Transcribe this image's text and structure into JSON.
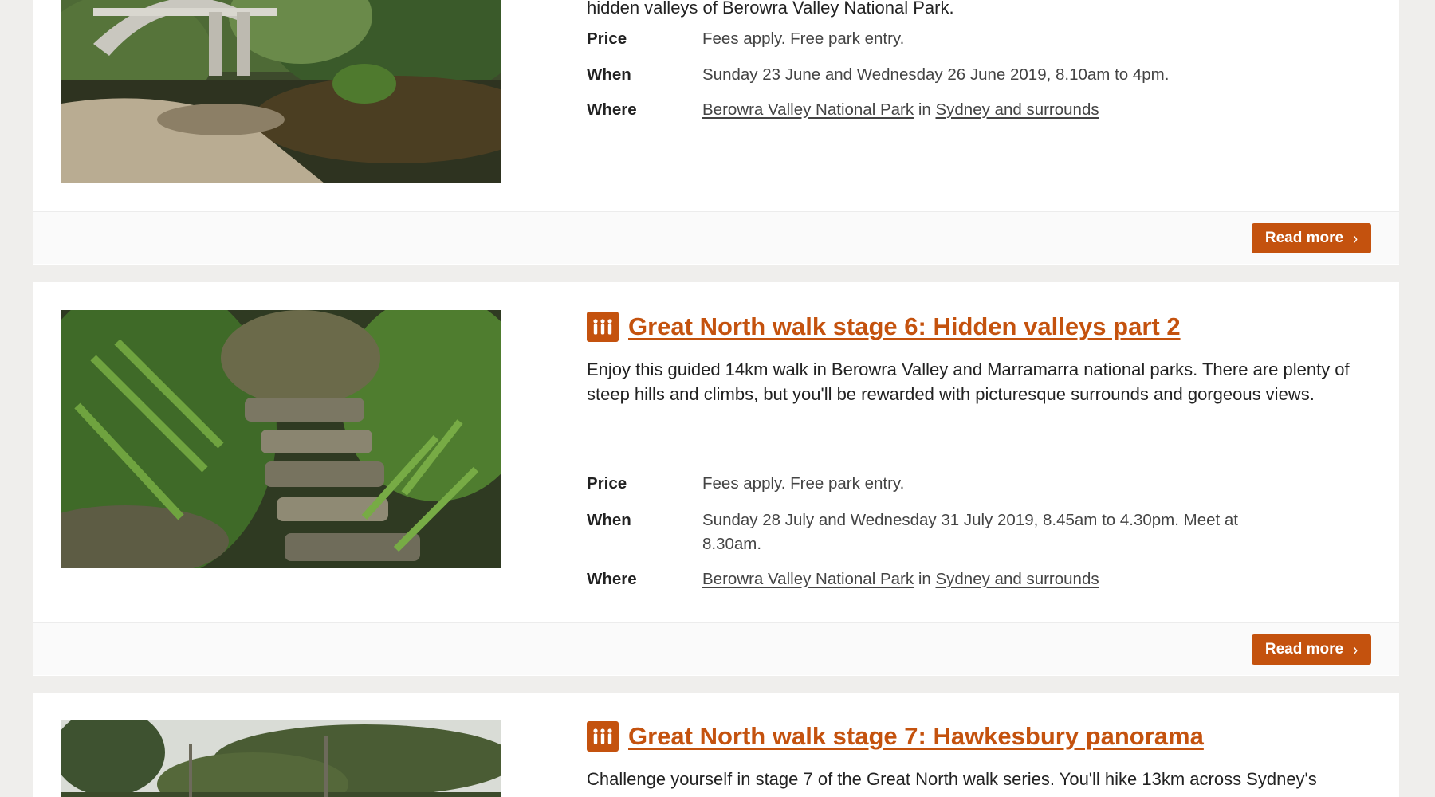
{
  "icons": {
    "walk": "guided-walk-people-icon",
    "chevron": "chevron-right-icon"
  },
  "colors": {
    "accent": "#c4520e",
    "background": "#efeeec",
    "card": "#ffffff",
    "footer": "#fafafa"
  },
  "labels": {
    "price": "Price",
    "when": "When",
    "where": "Where",
    "read_more": "Read more",
    "chevron": "›",
    "in": "in"
  },
  "cards": [
    {
      "desc_tail": "hidden valleys of Berowra Valley National Park.",
      "price": "Fees apply. Free park entry.",
      "when": "Sunday 23 June and Wednesday 26 June 2019, 8.10am to 4pm.",
      "park": "Berowra Valley National Park",
      "region": "Sydney and surrounds"
    },
    {
      "title": "Great North walk stage 6: Hidden valleys part 2",
      "description": "Enjoy this guided 14km walk in Berowra Valley and Marramarra national parks. There are plenty of steep hills and climbs, but you'll be rewarded with picturesque surrounds and gorgeous views.",
      "price": "Fees apply. Free park entry.",
      "when": "Sunday 28 July and Wednesday 31 July 2019, 8.45am to 4.30pm. Meet at 8.30am.",
      "park": "Berowra Valley National Park",
      "region": "Sydney and surrounds"
    },
    {
      "title": "Great North walk stage 7: Hawkesbury panorama",
      "description": "Challenge yourself in stage 7 of the Great North walk series. You'll hike 13km across Sydney's"
    }
  ]
}
